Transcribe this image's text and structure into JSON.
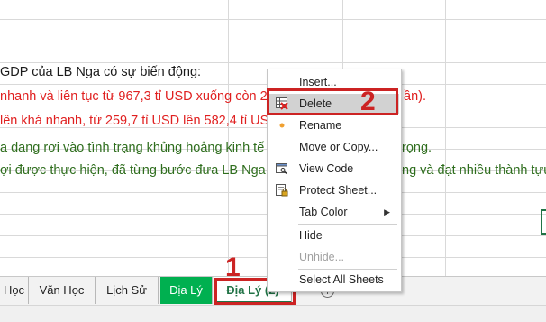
{
  "sheet": {
    "lines": [
      {
        "text": "GDP của LB Nga có sự biến động:",
        "color": "black"
      },
      {
        "text": "nhanh và liên tục từ 967,3 tỉ USD xuống còn 25",
        "tail": "ần).",
        "color": "red"
      },
      {
        "text": "lên khá nhanh, từ 259,7 tỉ USD lên 582,4 tỉ US",
        "color": "red"
      },
      {
        "text": "a đang rơi vào tình trạng khủng hoảng kinh tế",
        "tail": "rọng.",
        "color": "green"
      },
      {
        "text": "ợi được thực hiện, đã từng bước đưa LB Nga",
        "tail": "ng và đạt nhiều thành tựu.",
        "color": "green"
      }
    ]
  },
  "tabs": [
    {
      "label": "Học",
      "style": "normal"
    },
    {
      "label": "Văn Học",
      "style": "normal"
    },
    {
      "label": "Lịch Sử",
      "style": "normal"
    },
    {
      "label": "Địa Lý",
      "style": "green"
    },
    {
      "label": "Địa Lý (2)",
      "style": "active"
    }
  ],
  "add_sheet_symbol": "+",
  "context_menu": {
    "items": [
      {
        "label": "Insert...",
        "icon": "none",
        "disabled": false
      },
      {
        "label": "Delete",
        "icon": "delete-sheet-icon",
        "disabled": false,
        "highlighted": true
      },
      {
        "label": "Rename",
        "icon": "dot-icon",
        "disabled": false
      },
      {
        "label": "Move or Copy...",
        "icon": "none",
        "disabled": false
      },
      {
        "label": "View Code",
        "icon": "view-code-icon",
        "disabled": false
      },
      {
        "label": "Protect Sheet...",
        "icon": "protect-sheet-icon",
        "disabled": false
      },
      {
        "label": "Tab Color",
        "icon": "none",
        "disabled": false,
        "submenu": true
      },
      {
        "label": "Hide",
        "icon": "none",
        "disabled": false
      },
      {
        "label": "Unhide...",
        "icon": "none",
        "disabled": true
      },
      {
        "label": "Select All Sheets",
        "icon": "none",
        "disabled": false
      }
    ]
  },
  "annotations": {
    "step1": "1",
    "step2": "2"
  },
  "colors": {
    "highlight": "#cc2323",
    "excel_green": "#217346",
    "tab_green": "#00b050"
  }
}
